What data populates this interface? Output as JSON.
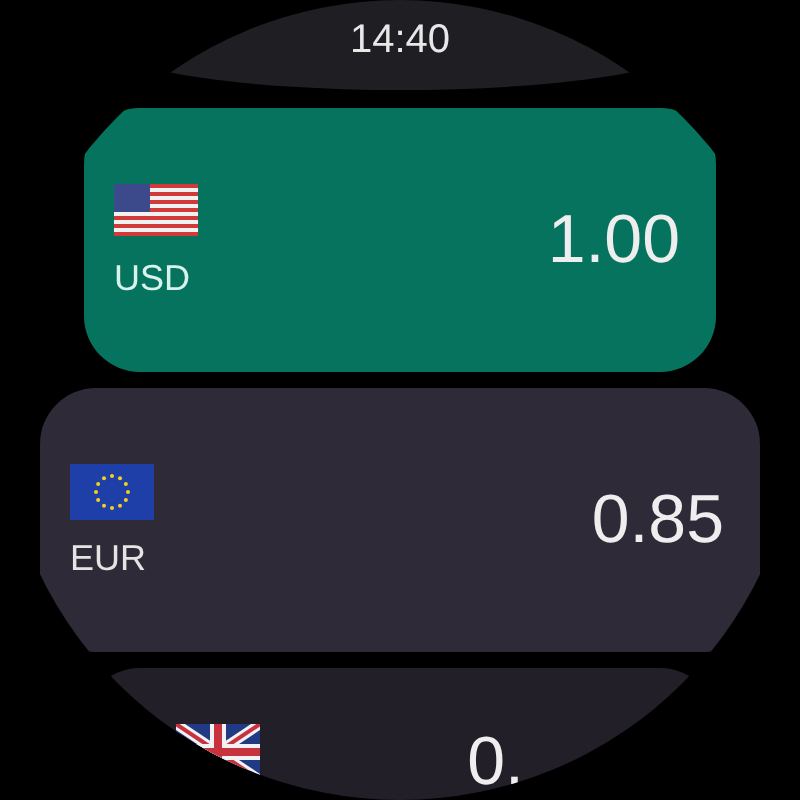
{
  "status_bar": {
    "time": "14:40"
  },
  "currencies": [
    {
      "kind": "us",
      "code": "USD",
      "value": "1.00",
      "selected": true
    },
    {
      "kind": "eu",
      "code": "EUR",
      "value": "0.85",
      "selected": false
    },
    {
      "kind": "gb",
      "value": "0.",
      "selected": false
    }
  ]
}
